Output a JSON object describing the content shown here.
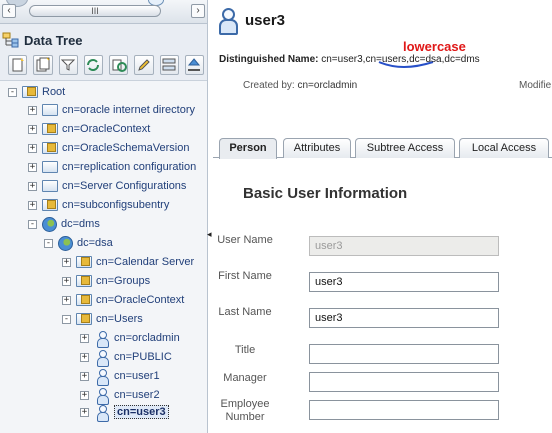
{
  "scrollbar": {
    "left_arrow": "‹",
    "right_arrow": "›",
    "thumb_grip": "III"
  },
  "tree_panel": {
    "title": "Data Tree",
    "root_label": "Root",
    "nodes": [
      {
        "label": "cn=oracle internet directory",
        "expander": "+"
      },
      {
        "label": "cn=OracleContext",
        "expander": "+"
      },
      {
        "label": "cn=OracleSchemaVersion",
        "expander": "+"
      },
      {
        "label": "cn=replication configuration",
        "expander": "+"
      },
      {
        "label": "cn=Server Configurations",
        "expander": "+"
      },
      {
        "label": "cn=subconfigsubentry",
        "expander": "+"
      },
      {
        "label": "dc=dms",
        "expander": "-"
      },
      {
        "label": "dc=dsa",
        "expander": "-"
      },
      {
        "label": "cn=Calendar Server",
        "expander": "+"
      },
      {
        "label": "cn=Groups",
        "expander": "+"
      },
      {
        "label": "cn=OracleContext",
        "expander": "+"
      },
      {
        "label": "cn=Users",
        "expander": "-"
      },
      {
        "label": "cn=orcladmin",
        "expander": "+"
      },
      {
        "label": "cn=PUBLIC",
        "expander": "+"
      },
      {
        "label": "cn=user1",
        "expander": "+"
      },
      {
        "label": "cn=user2",
        "expander": "+"
      },
      {
        "label": "cn=user3",
        "expander": "+",
        "selected": true
      }
    ],
    "root_expander": "-"
  },
  "splitter_arrow": "◂",
  "entry": {
    "title": "user3",
    "dn_label": "Distinguished Name:",
    "dn_value": "cn=user3,cn=users,dc=dsa,dc=dms",
    "annotation": "lowercase",
    "created_label": "Created by:",
    "created_value": "cn=orcladmin",
    "modified_label": "Modifie"
  },
  "tabs": [
    "Person",
    "Attributes",
    "Subtree Access",
    "Local Access"
  ],
  "form": {
    "section_title": "Basic User Information",
    "fields": [
      {
        "label": "User Name",
        "value": "user3"
      },
      {
        "label": "First Name",
        "value": "user3"
      },
      {
        "label": "Last Name",
        "value": "user3"
      },
      {
        "label": "Title",
        "value": ""
      },
      {
        "label": "Manager",
        "value": ""
      },
      {
        "label": "Employee Number",
        "value": ""
      }
    ]
  },
  "colors": {
    "annotation": "#e01818",
    "link": "#22407a",
    "accent": "#3c6aa8"
  }
}
